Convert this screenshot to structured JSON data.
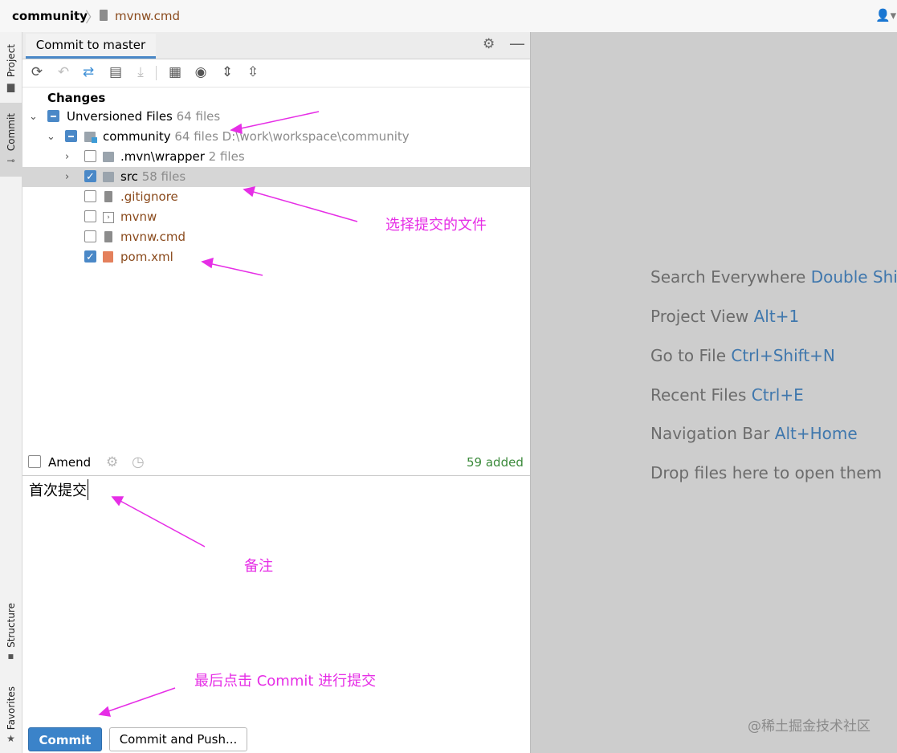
{
  "breadcrumb": {
    "project": "community",
    "separator": "〉",
    "file": "mvnw.cmd",
    "file_icon": "file-icon"
  },
  "top_right": {
    "user_icon": "user-icon"
  },
  "left_strip": {
    "project": "Project",
    "commit": "Commit",
    "structure": "Structure",
    "favorites": "Favorites"
  },
  "panel": {
    "tab": "Commit to master",
    "toolbar_icons": [
      "refresh-icon",
      "rollback-icon",
      "show-diff-icon",
      "shelve-icon",
      "update-icon",
      "group-by-icon",
      "view-options-icon",
      "expand-all-icon",
      "collapse-all-icon"
    ]
  },
  "changes": {
    "title": "Changes",
    "rows": [
      {
        "name": "Unversioned Files",
        "count": "64 files",
        "path": ""
      },
      {
        "name": "community",
        "count": "64 files",
        "path": "D:\\work\\workspace\\community"
      },
      {
        "name": ".mvn\\wrapper",
        "count": "2 files",
        "path": ""
      },
      {
        "name": "src",
        "count": "58 files",
        "path": ""
      },
      {
        "name": ".gitignore",
        "count": "",
        "path": ""
      },
      {
        "name": "mvnw",
        "count": "",
        "path": ""
      },
      {
        "name": "mvnw.cmd",
        "count": "",
        "path": ""
      },
      {
        "name": "pom.xml",
        "count": "",
        "path": ""
      }
    ]
  },
  "amend": {
    "label": "Amend",
    "added": "59 added"
  },
  "message": {
    "text": "首次提交"
  },
  "buttons": {
    "commit": "Commit",
    "commit_push": "Commit and Push..."
  },
  "editor_hints": [
    {
      "text": "Search Everywhere",
      "shortcut": "Double Shift"
    },
    {
      "text": "Project View",
      "shortcut": "Alt+1"
    },
    {
      "text": "Go to File",
      "shortcut": "Ctrl+Shift+N"
    },
    {
      "text": "Recent Files",
      "shortcut": "Ctrl+E"
    },
    {
      "text": "Navigation Bar",
      "shortcut": "Alt+Home"
    },
    {
      "text": "Drop files here to open them",
      "shortcut": ""
    }
  ],
  "annotations": {
    "select_files": "选择提交的文件",
    "note": "备注",
    "final": "最后点击 Commit 进行提交",
    "color": "#e62ee6"
  },
  "watermark": "@稀土掘金技术社区",
  "colors": {
    "accent": "#4a88c7",
    "commit_button": "#3b83c9",
    "added_green": "#3b8a3b",
    "unversioned_brown": "#8a4a1c",
    "shortcut_blue": "#3f77ad"
  }
}
